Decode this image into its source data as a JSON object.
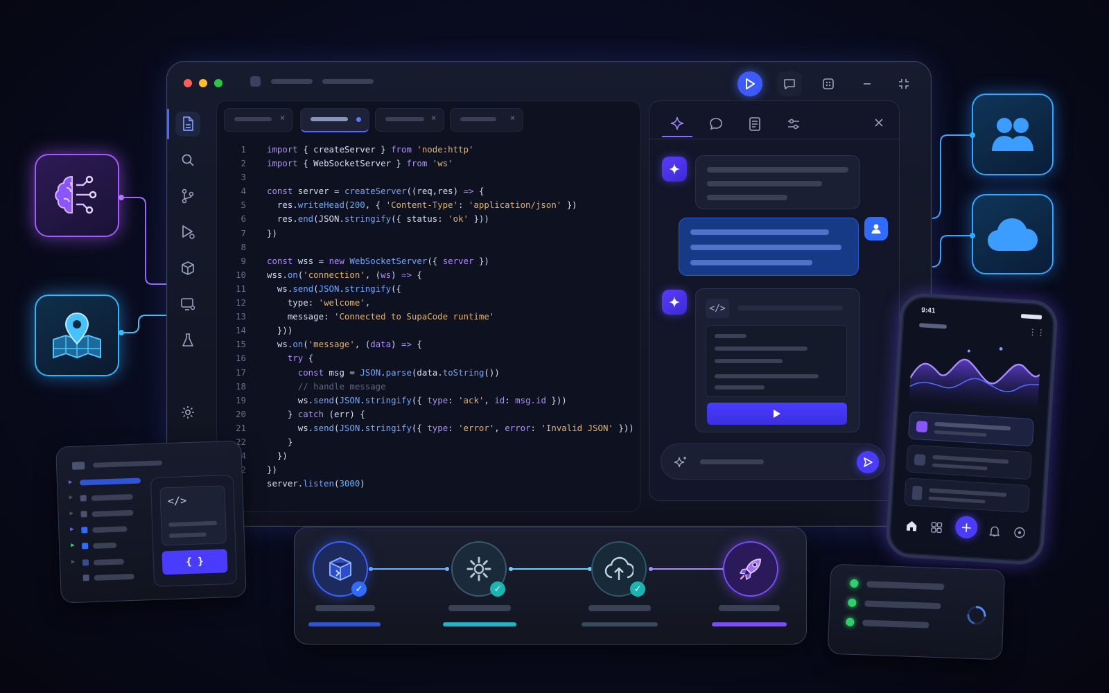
{
  "editor": {
    "lines": [
      {
        "n": "1",
        "html": "<span class=\"kw\">import</span> <span class=\"pl\">{ createServer }</span> <span class=\"kw\">from</span> <span class=\"st\">'node:http'</span>"
      },
      {
        "n": "2",
        "html": "<span class=\"kw\">import</span> <span class=\"pl\">{ WebSocketServer }</span> <span class=\"kw\">from</span> <span class=\"st\">'ws'</span>"
      },
      {
        "n": "3",
        "html": ""
      },
      {
        "n": "4",
        "html": "<span class=\"kw\">const</span> <span class=\"pl\">server</span> = <span class=\"fn\">createServer</span>((<span class=\"pl\">req</span>,<span class=\"pl\">res</span>) <span class=\"kw\">=&gt;</span> {"
      },
      {
        "n": "5",
        "html": "  <span class=\"pl\">res.</span><span class=\"fn\">writeHead</span>(<span class=\"nm\">200</span>, { <span class=\"st\">'Content-Type'</span>: <span class=\"st\">'application/json'</span> })"
      },
      {
        "n": "6",
        "html": "  <span class=\"pl\">res.</span><span class=\"fn\">end</span>(<span class=\"pl\">JSON.</span><span class=\"fn\">stringify</span>({ <span class=\"pl\">status</span>: <span class=\"st\">'ok'</span> }))"
      },
      {
        "n": "7",
        "html": "})"
      },
      {
        "n": "8",
        "html": ""
      },
      {
        "n": "9",
        "html": "<span class=\"kw\">const</span> <span class=\"pl\">wss</span> = <span class=\"kw\">new</span> <span class=\"fn\">WebSocketServer</span>({ <span class=\"kw\">server</span> })"
      },
      {
        "n": "10",
        "html": "<span class=\"pl\">wss.</span><span class=\"fn\">on</span>(<span class=\"st\">'connection'</span>, (<span class=\"kw\">ws</span>) <span class=\"kw\">=&gt;</span> {"
      },
      {
        "n": "11",
        "html": "  <span class=\"pl\">ws.</span><span class=\"fn\">send</span>(<span class=\"fn\">JSON</span>.<span class=\"fn\">stringify</span>({"
      },
      {
        "n": "12",
        "html": "    <span class=\"pl\">type</span>: <span class=\"st\">'welcome'</span>,"
      },
      {
        "n": "13",
        "html": "    <span class=\"pl\">message</span>: <span class=\"st\">'Connected to SupaCode runtime'</span>"
      },
      {
        "n": "14",
        "html": "  }))"
      },
      {
        "n": "15",
        "html": "  <span class=\"pl\">ws.</span><span class=\"fn\">on</span>(<span class=\"st\">'message'</span>, (<span class=\"kw\">data</span>) <span class=\"kw\">=&gt;</span> {"
      },
      {
        "n": "16",
        "html": "    <span class=\"kw\">try</span> {"
      },
      {
        "n": "17",
        "html": "      <span class=\"kw\">const</span> <span class=\"pl\">msg</span> = <span class=\"fn\">JSON</span>.<span class=\"fn\">parse</span>(<span class=\"pl\">data.</span><span class=\"fn\">toString</span>())"
      },
      {
        "n": "18",
        "html": "      <span class=\"cm\">// handle message</span>"
      },
      {
        "n": "19",
        "html": "      <span class=\"pl\">ws.</span><span class=\"fn\">send</span>(<span class=\"fn\">JSON</span>.<span class=\"fn\">stringify</span>({ <span class=\"kw\">type</span>: <span class=\"st\">'ack'</span>, <span class=\"kw\">id</span>: <span class=\"kw\">msg.id</span> }))"
      },
      {
        "n": "20",
        "html": "    } <span class=\"kw\">catch</span> (<span class=\"pl\">err</span>) {"
      },
      {
        "n": "21",
        "html": "      <span class=\"pl\">ws.</span><span class=\"fn\">send</span>(<span class=\"fn\">JSON</span>.<span class=\"fn\">stringify</span>({ <span class=\"kw\">type</span>: <span class=\"st\">'error'</span>, <span class=\"kw\">error</span>: <span class=\"st\">'Invalid JSON'</span> }))"
      },
      {
        "n": "22",
        "html": "    }"
      },
      {
        "n": "24",
        "html": "  })"
      },
      {
        "n": "22",
        "html": "})"
      },
      {
        "n": "",
        "html": "<span class=\"pl\">server.</span><span class=\"fn\">listen</span>(<span class=\"nm\">3000</span>)"
      }
    ]
  },
  "phone": {
    "time": "9:41"
  },
  "bracket_label": "{ }",
  "colors": {
    "accent": "#4f46ff",
    "cyan": "#35c6ff",
    "purple": "#8b5cff",
    "teal": "#1fb5c8"
  }
}
